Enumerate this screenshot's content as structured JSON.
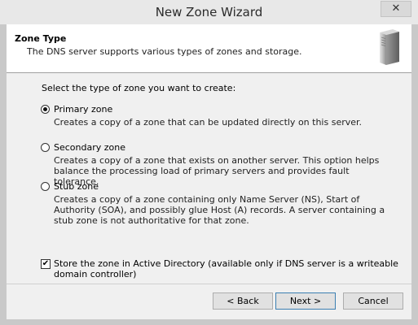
{
  "window": {
    "title": "New Zone Wizard",
    "close_glyph": "✕"
  },
  "header": {
    "title": "Zone Type",
    "subtitle": "The DNS server supports various types of zones and storage.",
    "icon": "server-icon"
  },
  "body": {
    "prompt": "Select the type of zone you want to create:",
    "options": [
      {
        "label": "Primary zone",
        "description": "Creates a copy of a zone that can be updated directly on this server.",
        "checked": true
      },
      {
        "label": "Secondary zone",
        "description": "Creates a copy of a zone that exists on another server. This option helps balance the processing load of primary servers and provides fault tolerance.",
        "checked": false
      },
      {
        "label": "Stub zone",
        "description": "Creates a copy of a zone containing only Name Server (NS), Start of Authority (SOA), and possibly glue Host (A) records. A server containing a stub zone is not authoritative for that zone.",
        "checked": false
      }
    ],
    "store_ad": {
      "label": "Store the zone in Active Directory (available only if DNS server is a writeable domain controller)",
      "checked": true,
      "check_glyph": "✔"
    }
  },
  "buttons": {
    "back": "< Back",
    "next": "Next >",
    "cancel": "Cancel"
  }
}
